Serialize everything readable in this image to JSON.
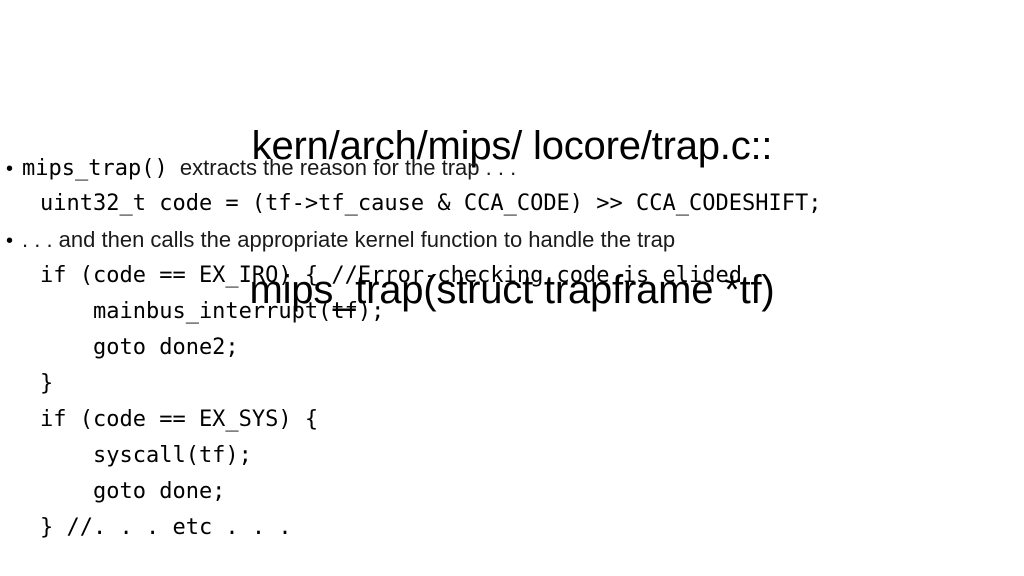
{
  "slide": {
    "background_color": "#ffffff",
    "text_color": "#000000",
    "prose_color": "#1a1a1a",
    "title": {
      "line1": "kern/arch/mips/ locore/trap.c::",
      "line2": "mips_trap(struct trapframe *tf)"
    },
    "bullets": [
      {
        "marker": "•",
        "code_part": "mips_trap()",
        "prose_part": "  extracts the reason for the trap . . ."
      },
      {
        "marker": "•",
        "code_part": "",
        "prose_part": ". . . and then calls the appropriate kernel function to handle the trap"
      }
    ],
    "code_block_1": [
      "uint32_t code = (tf->tf_cause & CCA_CODE) >> CCA_CODESHIFT;"
    ],
    "code_block_2": [
      "if (code == EX_IRQ) { //Error-checking code is elided",
      "    mainbus_interrupt(tf);",
      "    goto done2;",
      "}",
      "if (code == EX_SYS) {",
      "    syscall(tf);",
      "    goto done;",
      "} //. . . etc . . ."
    ]
  }
}
